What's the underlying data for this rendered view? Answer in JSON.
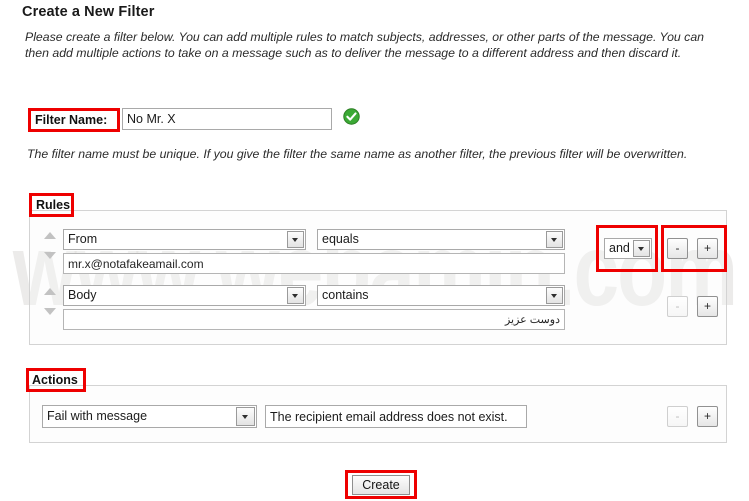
{
  "page": {
    "title": "Create a New Filter",
    "intro": "Please create a filter below. You can add multiple rules to match subjects, addresses, or other parts of the message. You can then add multiple actions to take on a message such as to deliver the message to a different address and then discard it.",
    "watermark": "www.webamin.com"
  },
  "filter_name": {
    "label": "Filter Name:",
    "value": "No Mr. X",
    "placeholder": "",
    "valid_icon": "check-circle-icon",
    "note": "The filter name must be unique. If you give the filter the same name as another filter, the previous filter will be overwritten."
  },
  "rules": {
    "heading": "Rules",
    "rows": [
      {
        "field": "From",
        "operator": "equals",
        "value": "mr.x@notafakeamail.com",
        "join": "and",
        "remove_label": "-",
        "add_label": "+",
        "move_up_icon": "triangle-up-icon",
        "move_down_icon": "triangle-down-icon"
      },
      {
        "field": "Body",
        "operator": "contains",
        "value": "دوست عزیز",
        "remove_label": "-",
        "add_label": "+",
        "move_up_icon": "triangle-up-icon",
        "move_down_icon": "triangle-down-icon"
      }
    ]
  },
  "actions": {
    "heading": "Actions",
    "rows": [
      {
        "action": "Fail with message",
        "message": "The recipient email address does not exist.",
        "remove_label": "-",
        "add_label": "+"
      }
    ]
  },
  "submit": {
    "label": "Create"
  },
  "colors": {
    "annotation": "#ee0000",
    "valid": "#3ba935"
  }
}
